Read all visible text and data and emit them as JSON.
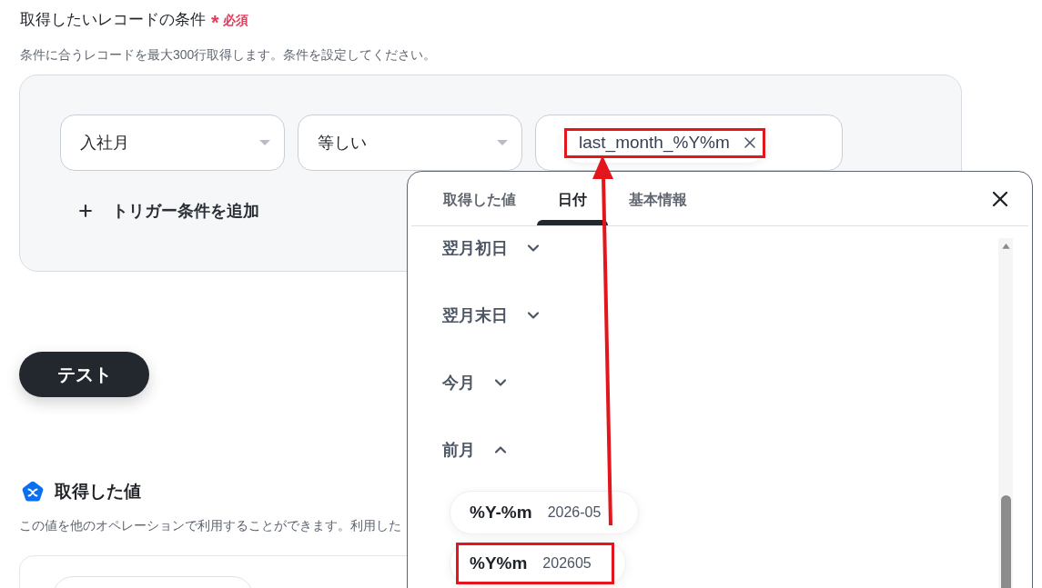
{
  "condition": {
    "title": "取得したいレコードの条件",
    "required_mark": "*",
    "required_label": "必須",
    "description": "条件に合うレコードを最大300行取得します。条件を設定してください。",
    "rows": [
      {
        "field": "入社月",
        "operator": "等しい",
        "value_chip": {
          "label": "last_month_%Y%m",
          "highlighted": true
        }
      }
    ],
    "add_button": "トリガー条件を追加"
  },
  "test_button": "テスト",
  "output": {
    "title": "取得した値",
    "description": "この値を他のオペレーションで利用することができます。利用した"
  },
  "picker": {
    "tabs": [
      {
        "label": "取得した値",
        "selected": false
      },
      {
        "label": "日付",
        "selected": true
      },
      {
        "label": "基本情報",
        "selected": false
      }
    ],
    "groups": [
      {
        "label": "翌月初日",
        "expanded": false
      },
      {
        "label": "翌月末日",
        "expanded": false
      },
      {
        "label": "今月",
        "expanded": false
      },
      {
        "label": "前月",
        "expanded": true,
        "options": [
          {
            "format": "%Y-%m",
            "example": "2026-05",
            "highlighted": false
          },
          {
            "format": "%Y%m",
            "example": "202605",
            "highlighted": true
          }
        ]
      }
    ]
  }
}
